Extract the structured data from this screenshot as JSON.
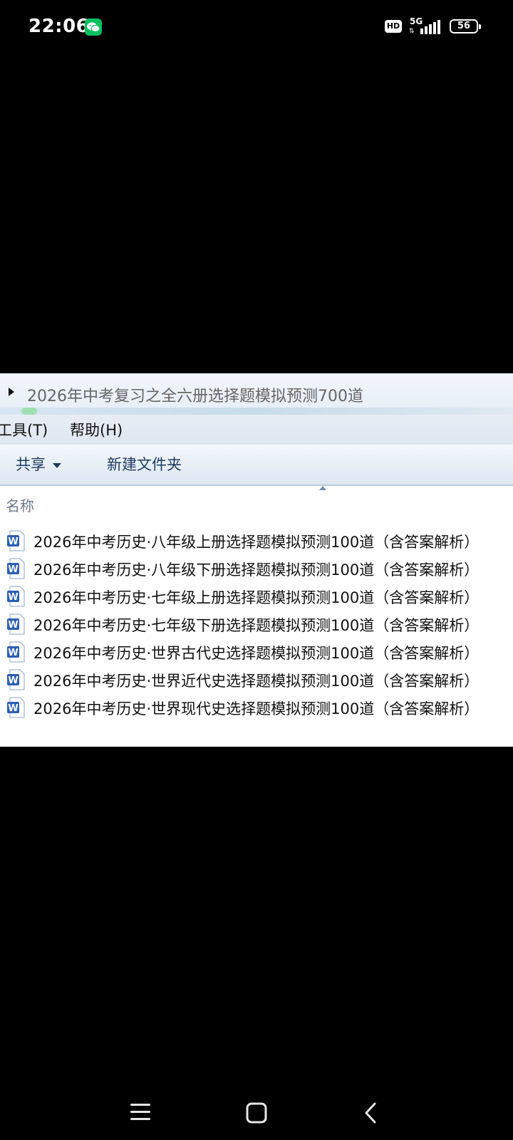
{
  "status_bar": {
    "time": "22:06",
    "hd_label": "HD",
    "network": "5G",
    "battery": "56"
  },
  "explorer": {
    "address_path": "2026年中考复习之全六册选择题模拟预测700道",
    "menu": {
      "tools": "工具(T)",
      "help": "帮助(H)"
    },
    "toolbar": {
      "share": "共享",
      "new_folder": "新建文件夹"
    },
    "column_header": "名称",
    "files": [
      "2026年中考历史·八年级上册选择题模拟预测100道（含答案解析）",
      "2026年中考历史·八年级下册选择题模拟预测100道（含答案解析）",
      "2026年中考历史·七年级上册选择题模拟预测100道（含答案解析）",
      "2026年中考历史·七年级下册选择题模拟预测100道（含答案解析）",
      "2026年中考历史·世界古代史选择题模拟预测100道（含答案解析）",
      "2026年中考历史·世界近代史选择题模拟预测100道（含答案解析）",
      "2026年中考历史·世界现代史选择题模拟预测100道（含答案解析）"
    ]
  },
  "colors": {
    "word_blue": "#2b5fb4",
    "wechat_green": "#07c160"
  }
}
